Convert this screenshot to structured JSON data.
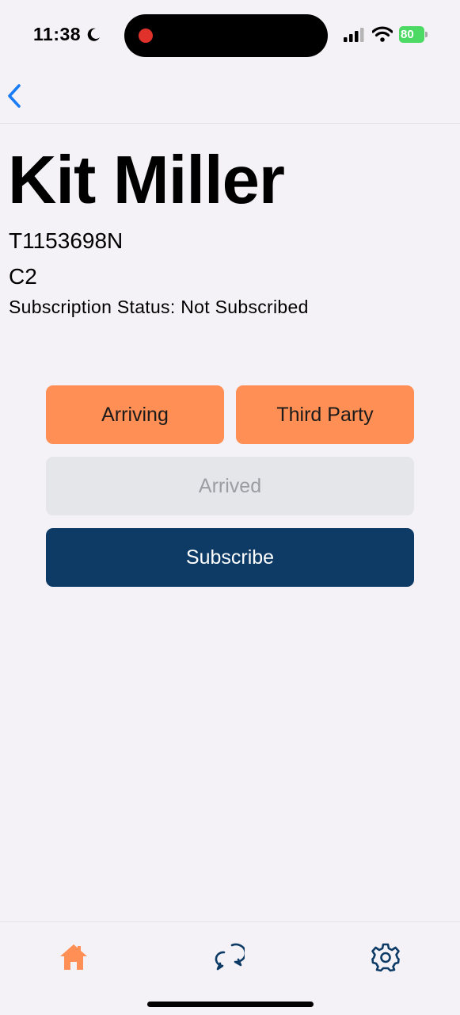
{
  "status_bar": {
    "time": "11:38",
    "battery": "80"
  },
  "nav": {
    "back_icon": "chevron-left-icon",
    "accent": "#1a7cf5"
  },
  "profile": {
    "name": "Kit Miller",
    "id": "T1153698N",
    "class": "C2",
    "subscription_status": "Subscription Status: Not Subscribed"
  },
  "actions": {
    "arriving": "Arriving",
    "third_party": "Third Party",
    "arrived": "Arrived",
    "subscribe": "Subscribe"
  },
  "colors": {
    "primary_orange": "#ff8f55",
    "disabled_gray": "#e5e6ea",
    "navy": "#0d3b66"
  },
  "tabs": [
    {
      "icon": "home-icon",
      "active": true
    },
    {
      "icon": "chat-bubbles-icon",
      "active": false
    },
    {
      "icon": "gear-icon",
      "active": false
    }
  ]
}
